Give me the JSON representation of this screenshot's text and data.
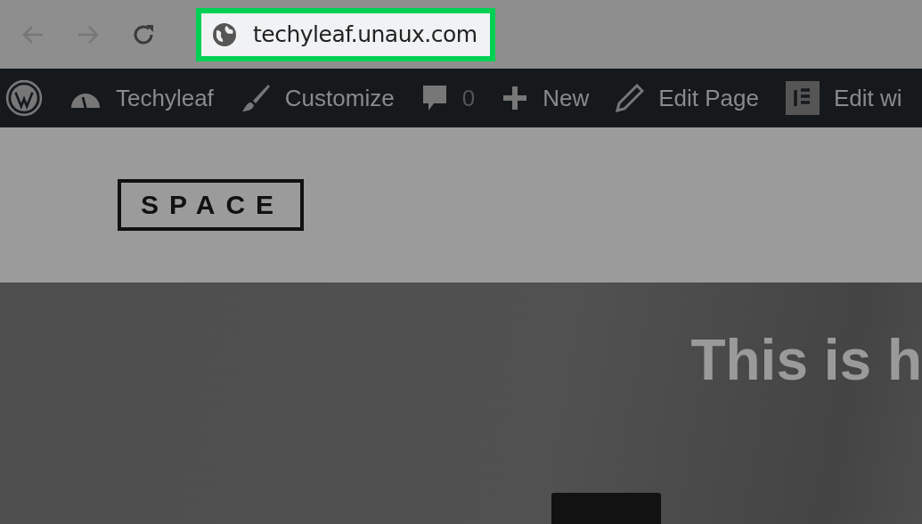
{
  "browser": {
    "address": "techyleaf.unaux.com",
    "highlighted": true
  },
  "admin_bar": {
    "items": [
      {
        "kind": "logo"
      },
      {
        "kind": "site",
        "label": "Techyleaf"
      },
      {
        "kind": "customize",
        "label": "Customize"
      },
      {
        "kind": "comments",
        "label": "0"
      },
      {
        "kind": "new",
        "label": "New"
      },
      {
        "kind": "edit",
        "label": "Edit Page"
      },
      {
        "kind": "elementor",
        "label": "Edit wi"
      }
    ]
  },
  "site_header": {
    "logo": "SPACE"
  },
  "hero": {
    "heading": "This is h"
  }
}
